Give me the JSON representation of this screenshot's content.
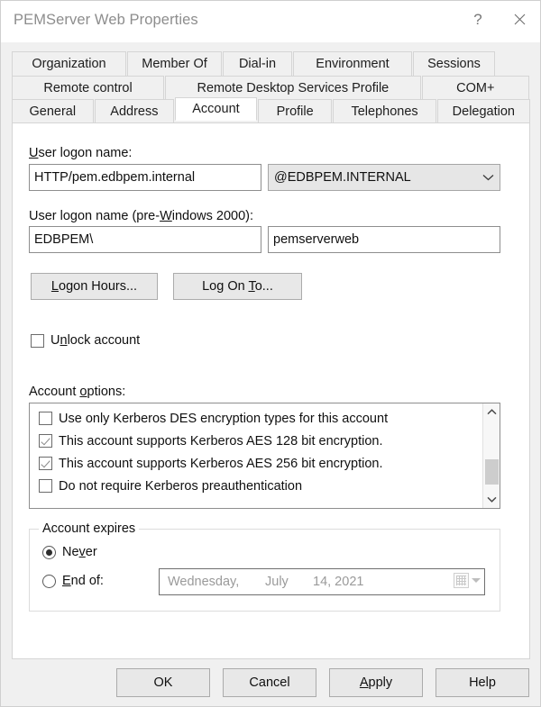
{
  "window": {
    "title": "PEMServer Web Properties",
    "help_icon": "question-mark-icon",
    "close_icon": "close-icon"
  },
  "tabs": {
    "row1": [
      {
        "label": "Organization",
        "selected": false
      },
      {
        "label": "Member Of",
        "selected": false
      },
      {
        "label": "Dial-in",
        "selected": false
      },
      {
        "label": "Environment",
        "selected": false
      },
      {
        "label": "Sessions",
        "selected": false
      }
    ],
    "row2": [
      {
        "label": "Remote control",
        "selected": false
      },
      {
        "label": "Remote Desktop Services Profile",
        "selected": false
      },
      {
        "label": "COM+",
        "selected": false
      }
    ],
    "row3": [
      {
        "label": "General",
        "selected": false
      },
      {
        "label": "Address",
        "selected": false
      },
      {
        "label": "Account",
        "selected": true
      },
      {
        "label": "Profile",
        "selected": false
      },
      {
        "label": "Telephones",
        "selected": false
      },
      {
        "label": "Delegation",
        "selected": false
      }
    ]
  },
  "account": {
    "logon_name_label_pre": "U",
    "logon_name_label_post": "ser logon name:",
    "logon_name_value": "HTTP/pem.edbpem.internal",
    "domain_suffix_value": "@EDBPEM.INTERNAL",
    "domain_suffix_chevron": "chevron-down-icon",
    "pre2000_label_a": "User logon name (pre-",
    "pre2000_label_key": "W",
    "pre2000_label_b": "indows 2000):",
    "pre2000_domain_value": "EDBPEM\\",
    "pre2000_name_value": "pemserverweb",
    "logon_hours_key": "L",
    "logon_hours_rest": "ogon Hours...",
    "log_on_to_a": "Lo",
    "log_on_to_key1": "g",
    "log_on_to_b": " On ",
    "log_on_to_key2": "T",
    "log_on_to_c": "o...",
    "unlock_a": "U",
    "unlock_key": "n",
    "unlock_b": "lock account",
    "unlock_checked": false,
    "options_label_a": "Account ",
    "options_label_key": "o",
    "options_label_b": "ptions:",
    "options": [
      {
        "label": "Use only Kerberos DES encryption types for this account",
        "checked": false
      },
      {
        "label": "This account supports Kerberos AES 128 bit encryption.",
        "checked": true
      },
      {
        "label": "This account supports Kerberos AES 256 bit encryption.",
        "checked": true
      },
      {
        "label": "Do not require Kerberos preauthentication",
        "checked": false
      }
    ],
    "scroll_up_icon": "chevron-up-icon",
    "scroll_down_icon": "chevron-down-icon",
    "expires_group_title": "Account expires",
    "never_a": "Ne",
    "never_key": "v",
    "never_b": "er",
    "never_selected": true,
    "endof_key": "E",
    "endof_rest": "nd of:",
    "endof_selected": false,
    "date_weekday": "Wednesday,",
    "date_month": "July",
    "date_day_year": "14, 2021",
    "calendar_icon": "calendar-icon",
    "calendar_dropdown_icon": "triangle-down-icon"
  },
  "footer": {
    "ok": "OK",
    "cancel": "Cancel",
    "apply_key": "A",
    "apply_rest": "pply",
    "help": "Help"
  }
}
